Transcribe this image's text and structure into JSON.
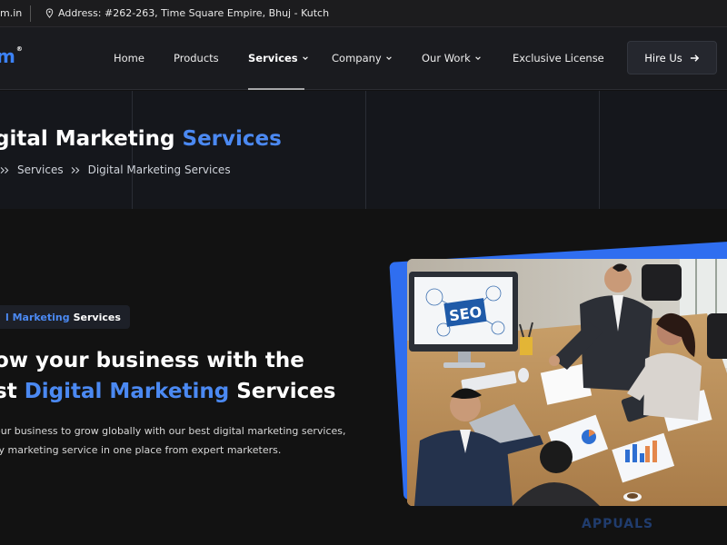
{
  "topbar": {
    "email": "m.in",
    "address": "Address: #262-263, Time Square Empire, Bhuj - Kutch"
  },
  "logo": {
    "text": "m",
    "tagline": ""
  },
  "nav": {
    "items": [
      {
        "label": "Home"
      },
      {
        "label": "Products"
      },
      {
        "label": "Services"
      },
      {
        "label": "Company"
      },
      {
        "label": "Our Work"
      },
      {
        "label": "Exclusive License"
      }
    ],
    "hire_label": "Hire Us"
  },
  "hero": {
    "title_main": "gital Marketing ",
    "title_accent": "Services",
    "breadcrumb": [
      "Services",
      "Digital Marketing Services"
    ]
  },
  "section": {
    "tag_accent": "l Marketing",
    "tag_main": "Services",
    "heading_line1": "ow your business with the",
    "heading_line2_start": "st ",
    "heading_line2_accent": "Digital Marketing",
    "heading_line2_end": " Services",
    "desc_line1": "our business to grow globally with our best digital marketing services,",
    "desc_line2": "ry marketing service in one place from expert marketers."
  },
  "photo": {
    "monitor_text": "SEO"
  },
  "watermark": "APPUALS",
  "colors": {
    "accent": "#4b89f2",
    "frame": "#2f6ef0",
    "background": "#121212"
  }
}
